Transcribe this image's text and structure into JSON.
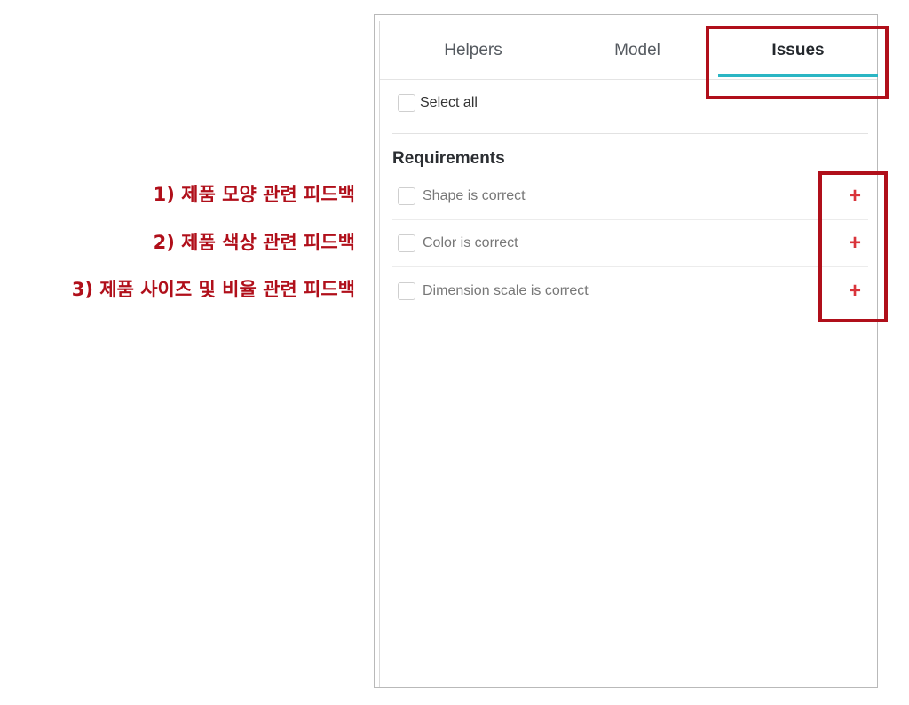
{
  "annotations": [
    "1) 제품 모양 관련 피드백",
    "2) 제품 색상 관련 피드백",
    "3) 제품 사이즈 및 비율 관련 피드백"
  ],
  "tabs": [
    {
      "label": "Helpers",
      "active": false
    },
    {
      "label": "Model",
      "active": false
    },
    {
      "label": "Issues",
      "active": true
    }
  ],
  "select_all": {
    "label": "Select all",
    "checked": false
  },
  "requirements": {
    "title": "Requirements",
    "items": [
      {
        "label": "Shape is correct",
        "checked": false,
        "action_icon": "plus-icon"
      },
      {
        "label": "Color is correct",
        "checked": false,
        "action_icon": "plus-icon"
      },
      {
        "label": "Dimension scale is correct",
        "checked": false,
        "action_icon": "plus-icon"
      }
    ]
  },
  "icons": {
    "plus": "+"
  },
  "colors": {
    "accent_tab": "#2bb6c4",
    "plus_icon": "#d9343b",
    "annotation": "#b00f1a"
  }
}
